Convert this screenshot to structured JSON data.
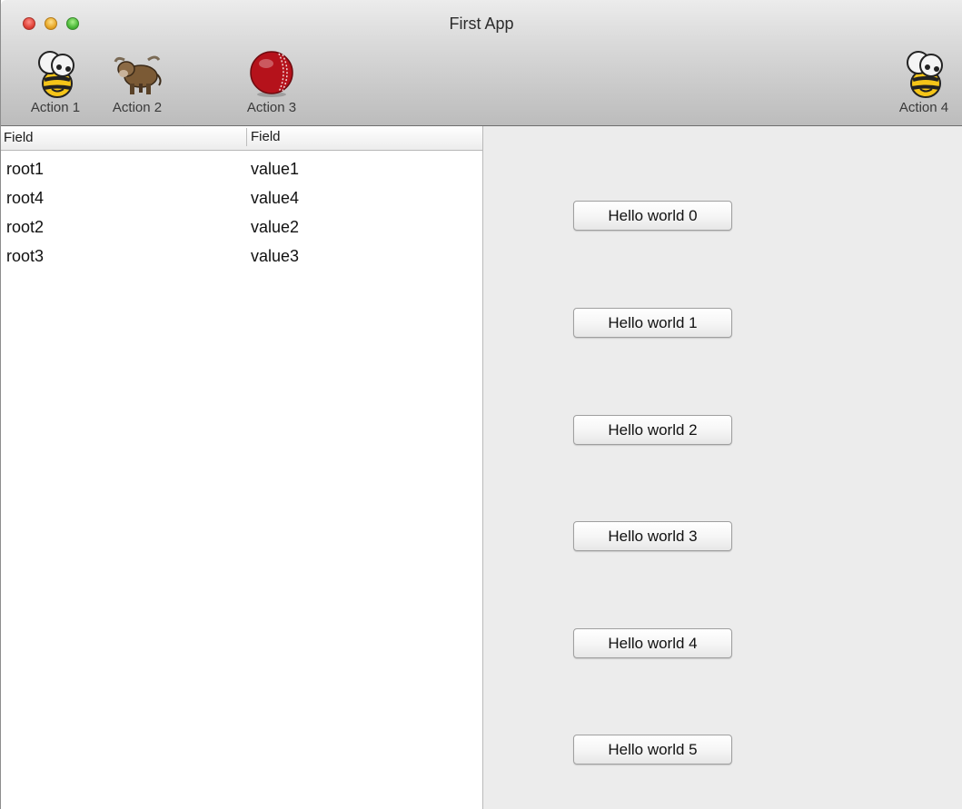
{
  "window": {
    "title": "First App"
  },
  "toolbar": {
    "actions": [
      {
        "label": "Action 1",
        "icon": "bee-icon"
      },
      {
        "label": "Action 2",
        "icon": "yak-icon"
      },
      {
        "label": "Action 3",
        "icon": "cricket-ball-icon"
      },
      {
        "label": "Action 4",
        "icon": "bee-icon"
      }
    ]
  },
  "table": {
    "columns": [
      "Field",
      "Field"
    ],
    "rows": [
      [
        "root1",
        "value1"
      ],
      [
        "root4",
        "value4"
      ],
      [
        "root2",
        "value2"
      ],
      [
        "root3",
        "value3"
      ]
    ]
  },
  "buttons": [
    "Hello world 0",
    "Hello world 1",
    "Hello world 2",
    "Hello world 3",
    "Hello world 4",
    "Hello world 5"
  ]
}
